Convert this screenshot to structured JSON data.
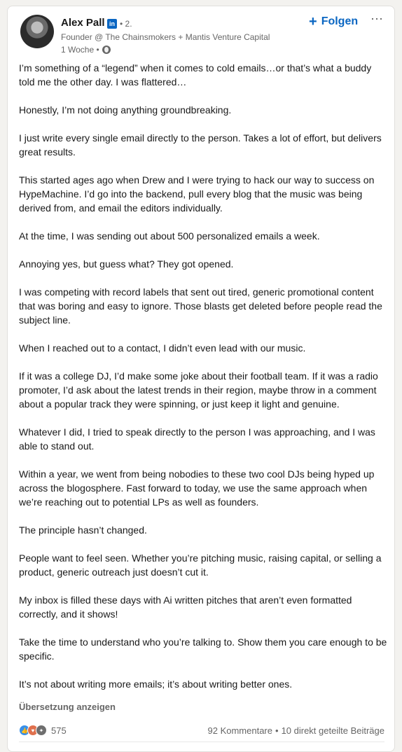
{
  "author": {
    "name": "Alex Pall",
    "badge": "in",
    "degree": "• 2.",
    "headline": "Founder @ The Chainsmokers + Mantis Venture Capital",
    "time": "1 Woche •"
  },
  "actions": {
    "follow_label": "Folgen",
    "follow_icon": "+",
    "more_icon": "⋯"
  },
  "post": {
    "paragraphs": [
      "I’m something of a “legend” when it comes to cold emails…or that’s what a buddy told me the other day. I was flattered…",
      "Honestly, I’m not doing anything groundbreaking.",
      "I just write every single email directly to the person. Takes a lot of effort, but delivers great results.",
      "This started ages ago when Drew and I were trying to hack our way to success on HypeMachine. I’d go into the backend, pull every blog that the music was being derived from, and email the editors individually.",
      "At the time, I was sending out about 500 personalized emails a week.",
      "Annoying yes, but guess what? They got opened.",
      "I was competing with record labels that sent out tired, generic promotional content that was boring and easy to ignore. Those blasts get deleted before people read the subject line.",
      "When I reached out to a contact, I didn’t even lead with our music.",
      "If it was a college DJ, I’d make some joke about their football team. If it was a radio promoter, I’d ask about the latest trends in their region, maybe throw in a comment about a popular track they were spinning, or just keep it light and genuine.",
      "Whatever I did, I tried to speak directly to the person I was approaching, and I was able to stand out.",
      "Within a year, we went from being nobodies to these two cool DJs being hyped up across the blogosphere. Fast forward to today, we use the same approach when we’re reaching out to potential LPs as well as founders.",
      "The principle hasn’t changed.",
      "People want to feel seen. Whether you’re pitching music, raising capital, or selling a product, generic outreach just doesn’t cut it.",
      "My inbox is filled these days with Ai written pitches that aren’t even formatted correctly, and it shows!",
      "Take the time to understand who you’re talking to. Show them you care enough to be specific.",
      "It’s not about writing more emails; it’s about writing better ones."
    ],
    "translate_label": "Übersetzung anzeigen"
  },
  "social": {
    "reaction_count": "575",
    "comments": "92 Kommentare",
    "separator": "•",
    "shares": "10 direkt geteilte Beiträge",
    "reaction_icons": [
      "like-icon",
      "love-icon",
      "insightful-icon"
    ]
  },
  "colors": {
    "accent": "#0a66c2",
    "muted": "#666666",
    "text": "#191919"
  }
}
